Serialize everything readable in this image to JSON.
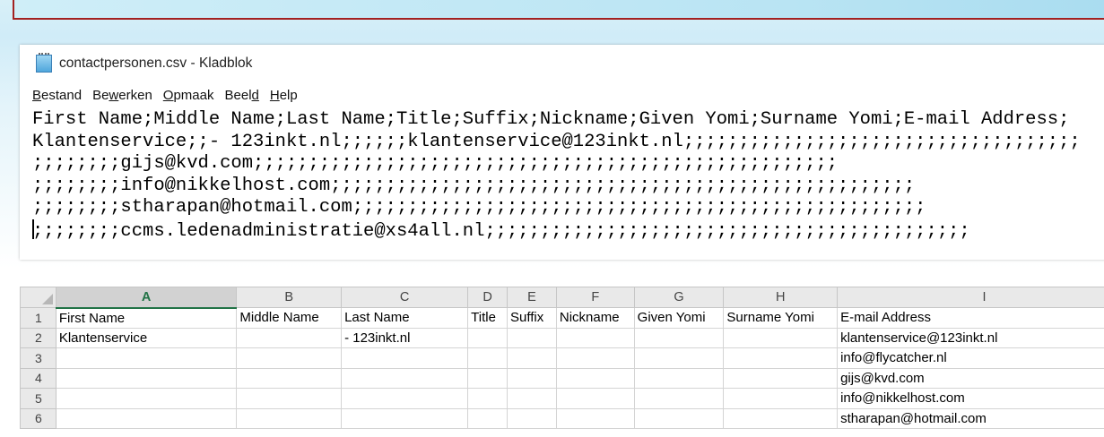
{
  "notepad": {
    "title": "contactpersonen.csv - Kladblok",
    "menu": [
      {
        "pre": "",
        "u": "B",
        "post": "estand"
      },
      {
        "pre": "Be",
        "u": "w",
        "post": "erken"
      },
      {
        "pre": "",
        "u": "O",
        "post": "pmaak"
      },
      {
        "pre": "Beel",
        "u": "d",
        "post": ""
      },
      {
        "pre": "",
        "u": "H",
        "post": "elp"
      }
    ],
    "lines": [
      "First Name;Middle Name;Last Name;Title;Suffix;Nickname;Given Yomi;Surname Yomi;E-mail Address;",
      "Klantenservice;;- 123inkt.nl;;;;;;klantenservice@123inkt.nl;;;;;;;;;;;;;;;;;;;;;;;;;;;;;;;;;;;;",
      ";;;;;;;;gijs@kvd.com;;;;;;;;;;;;;;;;;;;;;;;;;;;;;;;;;;;;;;;;;;;;;;;;;;;;;",
      ";;;;;;;;info@nikkelhost.com;;;;;;;;;;;;;;;;;;;;;;;;;;;;;;;;;;;;;;;;;;;;;;;;;;;;;",
      ";;;;;;;;stharapan@hotmail.com;;;;;;;;;;;;;;;;;;;;;;;;;;;;;;;;;;;;;;;;;;;;;;;;;;;;",
      ";;;;;;;;ccms.ledenadministratie@xs4all.nl;;;;;;;;;;;;;;;;;;;;;;;;;;;;;;;;;;;;;;;;;;;;"
    ]
  },
  "sheet": {
    "columns": [
      "A",
      "B",
      "C",
      "D",
      "E",
      "F",
      "G",
      "H",
      "I"
    ],
    "rows": [
      {
        "num": "1",
        "cells": [
          "First Name",
          "Middle Name",
          "Last Name",
          "Title",
          "Suffix",
          "Nickname",
          "Given Yomi",
          "Surname Yomi",
          "E-mail Address"
        ]
      },
      {
        "num": "2",
        "cells": [
          "Klantenservice",
          "",
          "- 123inkt.nl",
          "",
          "",
          "",
          "",
          "",
          "klantenservice@123inkt.nl"
        ]
      },
      {
        "num": "3",
        "cells": [
          "",
          "",
          "",
          "",
          "",
          "",
          "",
          "",
          "info@flycatcher.nl"
        ]
      },
      {
        "num": "4",
        "cells": [
          "",
          "",
          "",
          "",
          "",
          "",
          "",
          "",
          "gijs@kvd.com"
        ]
      },
      {
        "num": "5",
        "cells": [
          "",
          "",
          "",
          "",
          "",
          "",
          "",
          "",
          "info@nikkelhost.com"
        ]
      },
      {
        "num": "6",
        "cells": [
          "",
          "",
          "",
          "",
          "",
          "",
          "",
          "",
          "stharapan@hotmail.com"
        ]
      }
    ]
  }
}
